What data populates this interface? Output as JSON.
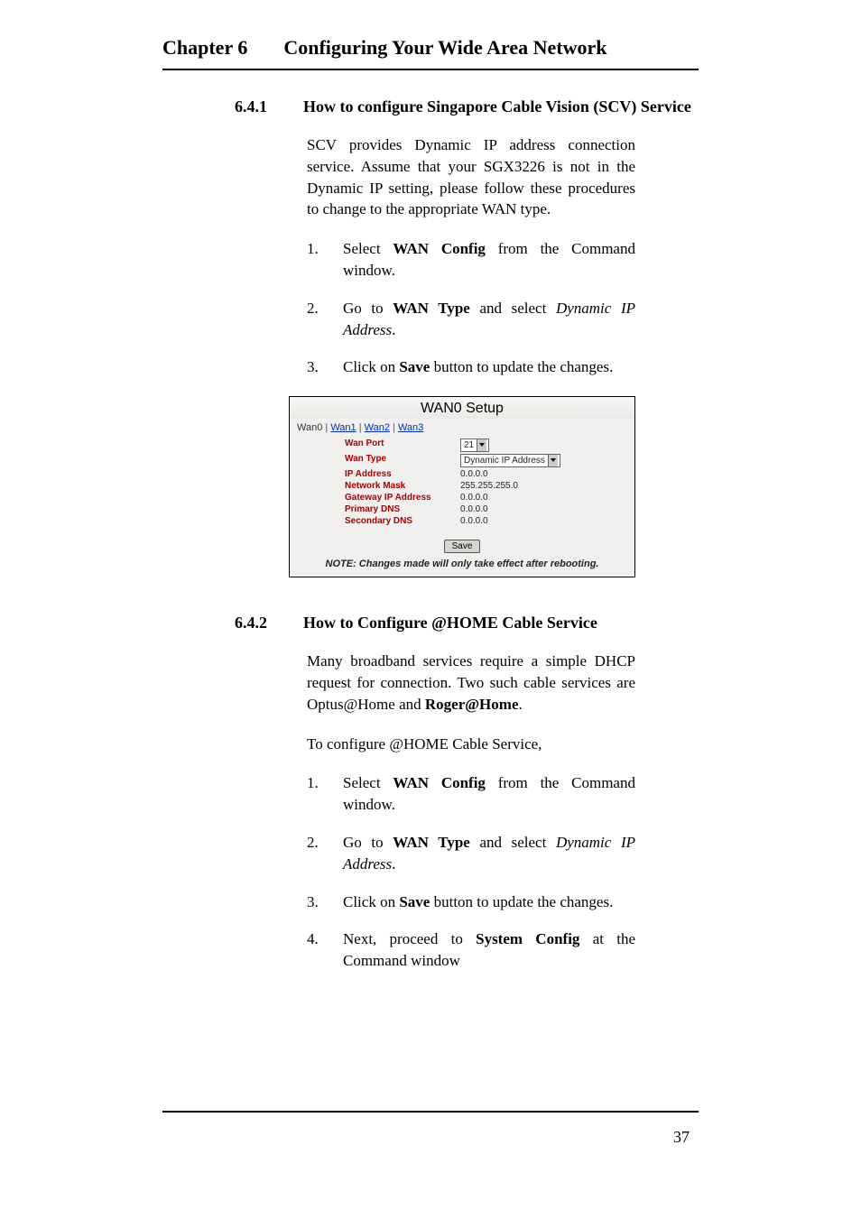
{
  "header": {
    "chapter": "Chapter 6",
    "title": "Configuring Your Wide Area Network"
  },
  "section641": {
    "num": "6.4.1",
    "title": "How to configure Singapore Cable Vision (SCV) Service",
    "para": "SCV provides Dynamic IP address connection service. Assume that your SGX3226 is not in the Dynamic IP setting, please follow these procedures to change to the appropriate WAN type.",
    "steps": [
      {
        "n": "1.",
        "pre": "Select ",
        "b1": "WAN Config",
        "mid": " from the Command window.",
        "ital": "",
        "post": ""
      },
      {
        "n": "2.",
        "pre": "Go to ",
        "b1": "WAN Type",
        "mid": " and select ",
        "ital": "Dynamic IP Address",
        "post": "."
      },
      {
        "n": "3.",
        "pre": "Click on ",
        "b1": "Save",
        "mid": " button to update the changes.",
        "ital": "",
        "post": ""
      }
    ]
  },
  "screenshot": {
    "title": "WAN0 Setup",
    "tabs": {
      "active": "Wan0",
      "links": [
        "Wan1",
        "Wan2",
        "Wan3"
      ]
    },
    "fields": {
      "wan_port_label": "Wan Port",
      "wan_port_value": "21",
      "wan_type_label": "Wan Type",
      "wan_type_value": "Dynamic IP Address",
      "ip_label": "IP Address",
      "ip_value": "0.0.0.0",
      "mask_label": "Network Mask",
      "mask_value": "255.255.255.0",
      "gw_label": "Gateway IP Address",
      "gw_value": "0.0.0.0",
      "pdns_label": "Primary DNS",
      "pdns_value": "0.0.0.0",
      "sdns_label": "Secondary DNS",
      "sdns_value": "0.0.0.0"
    },
    "button": "Save",
    "note": "NOTE: Changes made will only take effect after rebooting."
  },
  "section642": {
    "num": "6.4.2",
    "title": "How to Configure @HOME Cable Service",
    "para1a": "Many broadband services require a simple DHCP request for connection. Two such cable services are Optus@Home and ",
    "para1b": "Roger@Home",
    "para1c": ".",
    "para2": "To configure @HOME Cable Service,",
    "steps": [
      {
        "n": "1.",
        "pre": "Select ",
        "b1": "WAN Config",
        "mid": " from the Command window.",
        "ital": "",
        "post": ""
      },
      {
        "n": "2.",
        "pre": "Go to ",
        "b1": "WAN Type",
        "mid": " and select ",
        "ital": "Dynamic IP Address",
        "post": "."
      },
      {
        "n": "3.",
        "pre": "Click on ",
        "b1": "Save",
        "mid": " button to update the changes.",
        "ital": "",
        "post": ""
      },
      {
        "n": "4.",
        "pre": "Next, proceed to ",
        "b1": "System Config",
        "mid": " at the Command window",
        "ital": "",
        "post": ""
      }
    ]
  },
  "page_number": "37"
}
